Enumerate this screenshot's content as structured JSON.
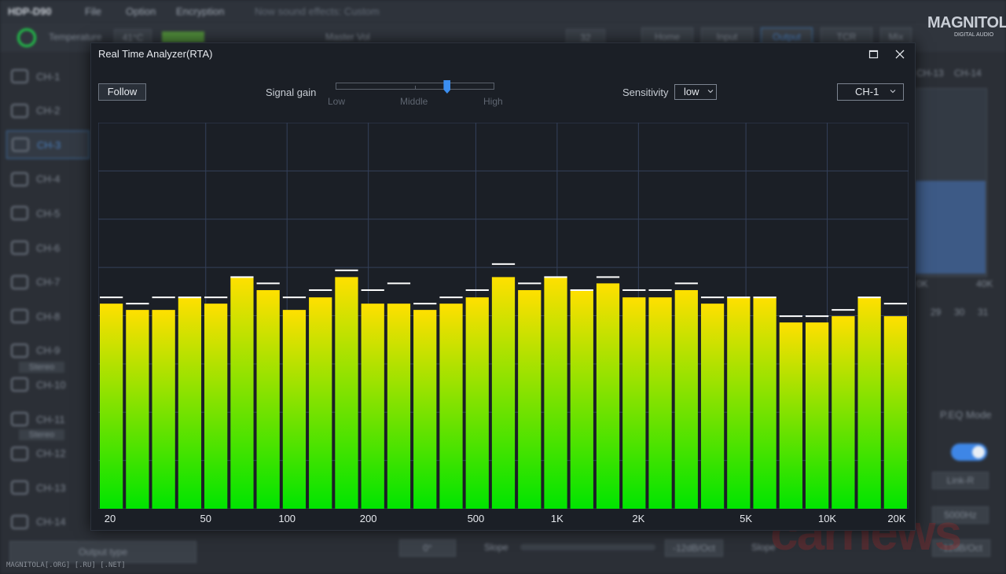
{
  "background_app": {
    "app_title": "HDP-D90",
    "menu": [
      "File",
      "Option",
      "Encryption"
    ],
    "sound_effects": "Now sound effects: Custom",
    "temperature_label": "Temperature",
    "temperature_value": "41°C",
    "master_vol_label": "Master Vol",
    "master_vol_value": "32",
    "tabs": [
      "Home",
      "Input",
      "Output",
      "TCR",
      "Mix"
    ],
    "channels": [
      "CH-1",
      "CH-2",
      "CH-3",
      "CH-4",
      "CH-5",
      "CH-6",
      "CH-7",
      "CH-8",
      "CH-9",
      "CH-10",
      "CH-11",
      "CH-12",
      "CH-13",
      "CH-14"
    ],
    "active_channel": "CH-3",
    "stereo_label": "Stereo",
    "right_channel_labels": [
      "CH-13",
      "CH-14"
    ],
    "right_freq_labels": [
      "0K",
      "40K"
    ],
    "right_band_numbers": [
      "29",
      "30",
      "31"
    ],
    "peq_mode_label": "P.EQ Mode",
    "link_label": "Link-R",
    "freq_value": "5000Hz",
    "slope_label": "Slope",
    "slope_value": "-12dB/Oct",
    "output_type_label": "Output type",
    "phase_value": "0°"
  },
  "logo": {
    "text": "MAGNITOLA",
    "sub": "DIGITAL AUDIO"
  },
  "watermark": "MAGNITOLA[.ORG] [.RU] [.NET]",
  "watermark_brand": "carnews",
  "rta": {
    "title": "Real Time Analyzer(RTA)",
    "follow_label": "Follow",
    "signal_gain_label": "Signal gain",
    "gain_ticks": [
      "Low",
      "Middle",
      "High"
    ],
    "gain_value": 0.7,
    "sensitivity_label": "Sensitivity",
    "sensitivity_value": "low",
    "channel_value": "CH-1",
    "icons": [
      "maximize-icon",
      "close-icon",
      "chevron-down-icon"
    ],
    "colors": {
      "bar_top": "#ffe000",
      "bar_bottom": "#00e400",
      "peak": "#ffffff",
      "grid": "#34405a",
      "background": "#1b1f26"
    }
  },
  "chart_data": {
    "type": "bar",
    "x_scale": "log",
    "x_range": [
      20,
      20000
    ],
    "x_ticks": [
      20,
      50,
      100,
      200,
      500,
      1000,
      2000,
      5000,
      10000,
      20000
    ],
    "x_tick_labels": [
      "20",
      "50",
      "100",
      "200",
      "500",
      "1K",
      "2K",
      "5K",
      "10K",
      "20K"
    ],
    "y_range": [
      0,
      8
    ],
    "grid": true,
    "series": [
      {
        "values": [
          4.25,
          4.12,
          4.12,
          4.38,
          4.25,
          4.8,
          4.53,
          4.12,
          4.38,
          4.8,
          4.25,
          4.25,
          4.12,
          4.25,
          4.38,
          4.8,
          4.53,
          4.8,
          4.53,
          4.67,
          4.38,
          4.38,
          4.53,
          4.25,
          4.38,
          4.38,
          3.86,
          3.86,
          3.99,
          4.38,
          3.99
        ]
      },
      {
        "values": [
          4.38,
          4.25,
          4.38,
          4.38,
          4.38,
          4.8,
          4.67,
          4.38,
          4.53,
          4.94,
          4.53,
          4.67,
          4.25,
          4.38,
          4.53,
          5.07,
          4.67,
          4.8,
          4.53,
          4.8,
          4.53,
          4.53,
          4.67,
          4.38,
          4.38,
          4.38,
          3.99,
          3.99,
          4.12,
          4.38,
          4.25
        ]
      }
    ]
  }
}
